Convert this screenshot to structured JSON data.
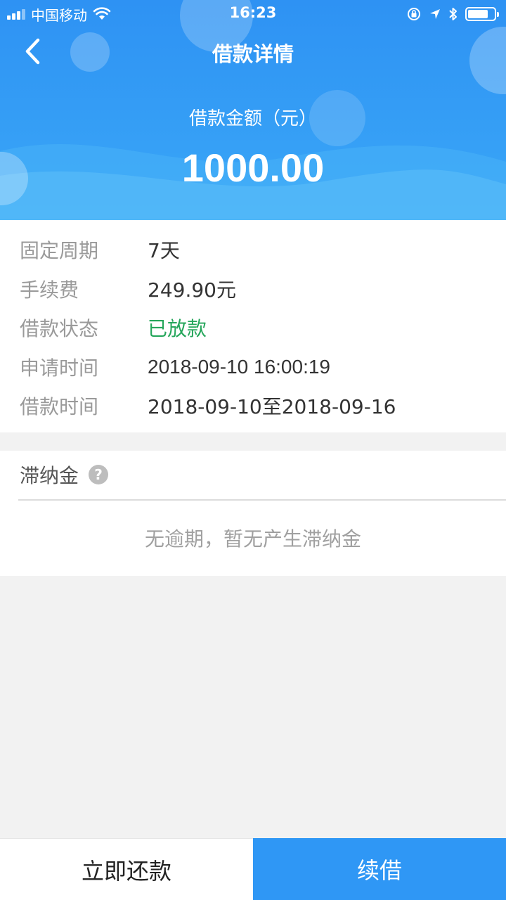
{
  "status_bar": {
    "carrier": "中国移动",
    "time": "16:23"
  },
  "nav": {
    "title": "借款详情",
    "back_icon": "chevron-left-icon"
  },
  "amount": {
    "label": "借款金额（元）",
    "value": "1000.00"
  },
  "details": [
    {
      "label": "固定周期",
      "value": "7天"
    },
    {
      "label": "手续费",
      "value": "249.90元"
    },
    {
      "label": "借款状态",
      "value": "已放款"
    },
    {
      "label": "申请时间",
      "value": "2018-09-10 16:00:19"
    },
    {
      "label": "借款时间",
      "value": "2018-09-10至2018-09-16"
    }
  ],
  "late_fee": {
    "title": "滞纳金",
    "help_icon": "question-icon",
    "help_glyph": "?",
    "empty_text": "无逾期，暂无产生滞纳金"
  },
  "actions": {
    "repay_label": "立即还款",
    "renew_label": "续借"
  },
  "colors": {
    "primary": "#2f97f5",
    "success": "#25a65b",
    "background": "#f2f2f2"
  }
}
